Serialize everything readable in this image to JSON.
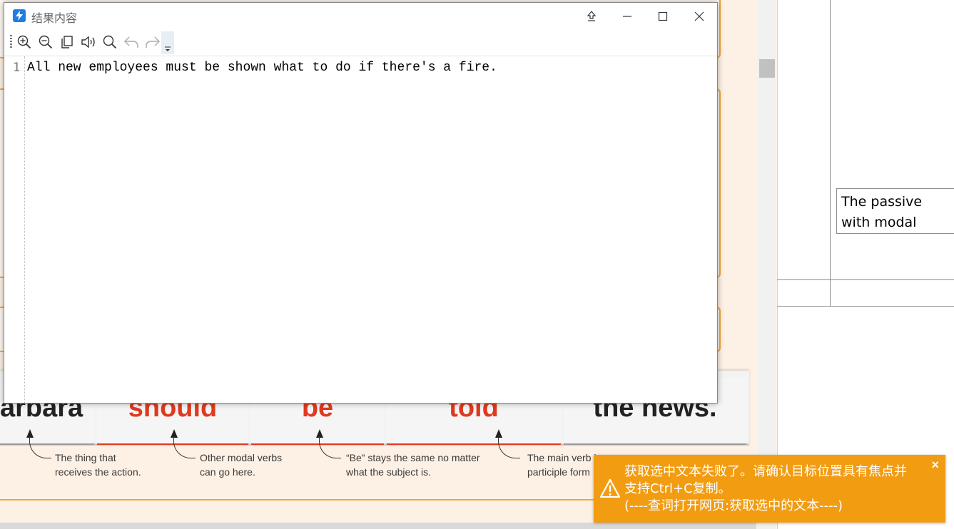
{
  "window": {
    "title": "结果内容",
    "content_line_number": "1",
    "content_text": "All new employees must be shown what to do if there's a fire."
  },
  "toolbar": {
    "icons": [
      "zoom-in-icon",
      "zoom-out-icon",
      "copy-icon",
      "speak-icon",
      "search-icon",
      "undo-icon",
      "redo-icon",
      "more-icon"
    ]
  },
  "background_doc": {
    "words": [
      "arbara",
      "should",
      "be",
      "told",
      "the news."
    ],
    "notes": [
      "The thing that\nreceives the action.",
      "Other modal verbs\ncan go here.",
      "“Be” stays the same no matter\nwhat the subject is.",
      "The main verb i\nparticiple form"
    ]
  },
  "right_doc": {
    "cell_text": "The passive\nwith modal"
  },
  "toast": {
    "line1": "获取选中文本失败了。请确认目标位置具有焦点并",
    "line2": "支持Ctrl+C复制。",
    "line3": "(----查词打开网页:获取选中的文本----)",
    "close_glyph": "×"
  },
  "colors": {
    "toast_bg": "#f29c12",
    "accent_red": "#e0391f",
    "doc_border": "#f0a83a"
  }
}
